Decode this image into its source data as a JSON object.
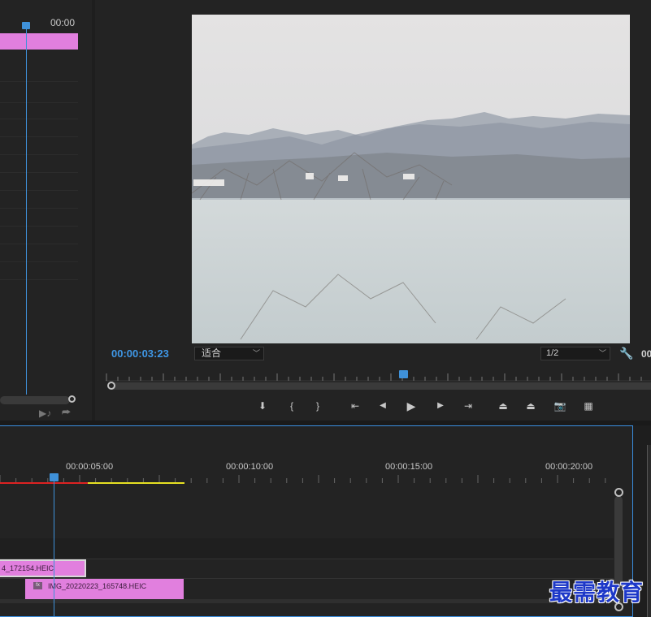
{
  "source_panel": {
    "timecode": "00:00",
    "audio_icon": "audio-note-icon",
    "export_icon": "export-frame-icon"
  },
  "program_monitor": {
    "timecode": "00:00:03:23",
    "fit_select": "适合",
    "resolution_select": "1/2",
    "right_timecode": "00",
    "settings_icon": "wrench-icon",
    "playhead_progress": 0.545,
    "transport": [
      {
        "name": "add-marker-button",
        "glyph": "⬇"
      },
      {
        "name": "mark-in-button",
        "glyph": "{"
      },
      {
        "name": "mark-out-button",
        "glyph": "}"
      },
      {
        "name": "go-to-in-button",
        "glyph": "⇤"
      },
      {
        "name": "step-back-button",
        "glyph": "◀"
      },
      {
        "name": "play-button",
        "glyph": "▶"
      },
      {
        "name": "step-forward-button",
        "glyph": "▶"
      },
      {
        "name": "go-to-out-button",
        "glyph": "⇥"
      },
      {
        "name": "lift-button",
        "glyph": "⏏"
      },
      {
        "name": "extract-button",
        "glyph": "⏏"
      },
      {
        "name": "export-frame-button",
        "glyph": "📷"
      },
      {
        "name": "compare-view-button",
        "glyph": "▦"
      }
    ]
  },
  "timeline": {
    "time_labels": [
      "00:00:05:00",
      "00:00:10:00",
      "00:00:15:00",
      "00:00:20:00"
    ],
    "clips": [
      {
        "label": "4_172154.HEIC"
      },
      {
        "label": "IMG_20220223_165748.HEIC",
        "fx": "fx"
      }
    ]
  },
  "watermark": "最需教育",
  "colors": {
    "accent_blue": "#3f91d9",
    "clip_pink": "#e17fde",
    "render_red": "#dd2222",
    "render_yellow": "#e6e022"
  }
}
